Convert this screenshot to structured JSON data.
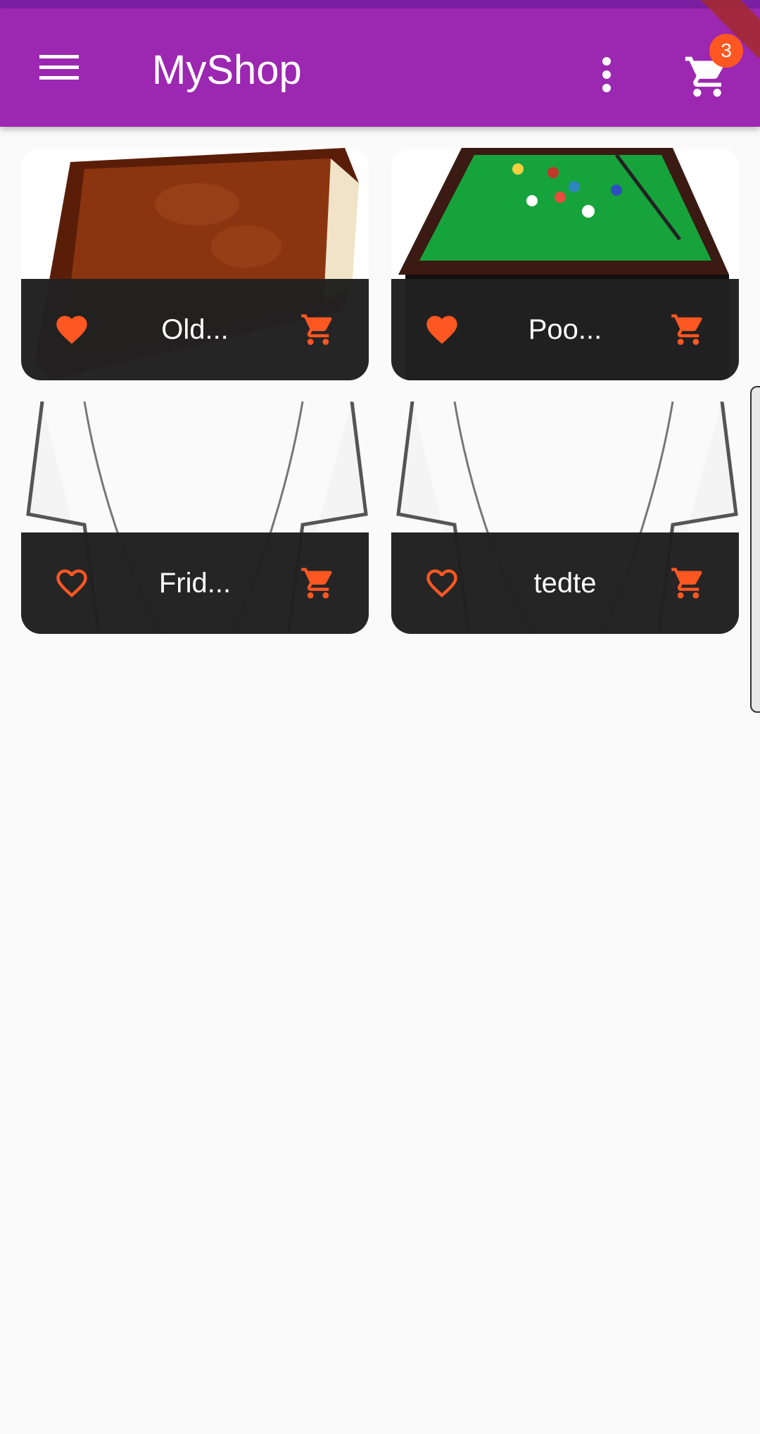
{
  "appbar": {
    "title": "MyShop",
    "cart_badge": "3",
    "icons": {
      "menu": "menu-icon",
      "more": "more-vert-icon",
      "cart": "shopping-cart-icon"
    },
    "color": "#9c27b0"
  },
  "accent_color": "#ff5722",
  "products": [
    {
      "title": "Old...",
      "favorite": true,
      "image": "old-book-image",
      "favorite_icon": "heart-filled-icon",
      "cart_icon": "add-to-cart-icon"
    },
    {
      "title": "Poo...",
      "favorite": true,
      "image": "pool-table-image",
      "favorite_icon": "heart-filled-icon",
      "cart_icon": "add-to-cart-icon"
    },
    {
      "title": "Frid...",
      "favorite": false,
      "image": "coat-sketch-image",
      "favorite_icon": "heart-outline-icon",
      "cart_icon": "add-to-cart-icon"
    },
    {
      "title": "tedte",
      "favorite": false,
      "image": "coat-sketch-image",
      "favorite_icon": "heart-outline-icon",
      "cart_icon": "add-to-cart-icon"
    }
  ]
}
